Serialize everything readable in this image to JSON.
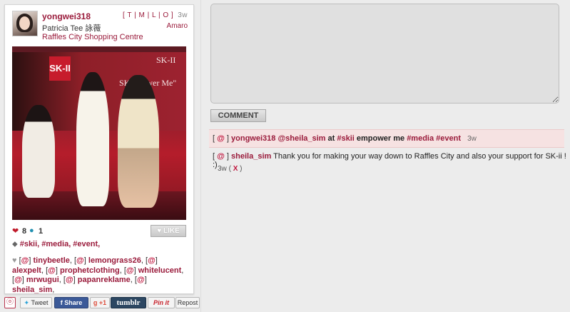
{
  "post": {
    "username": "yongwei318",
    "links": [
      "T",
      "M",
      "L",
      "O"
    ],
    "time": "3w",
    "filter": "Amaro",
    "full_name": "Patricia Tee 詠薇",
    "location": "Raffles City Shopping Centre",
    "photo_text": {
      "brand": "SK-II",
      "brand_small": "SK-II",
      "slogan": "SK-I  power Me\""
    },
    "likes_count": "8",
    "comments_count": "1",
    "like_button_label": "LIKE",
    "tags": "#skii, #media, #event,",
    "liked_by": [
      "tinybeetle",
      "lemongrass26",
      "alexpelt",
      "prophetclothing",
      "whitelucent",
      "mrwugui",
      "papanreklame",
      "sheila_sim"
    ]
  },
  "share": {
    "instagram": "ⓞ",
    "tweet": "Tweet",
    "facebook": "Share",
    "gplus": "+1",
    "gplus_icon": "g",
    "tumblr": "tumblr",
    "pinterest": "Pin it",
    "repost": "Repost"
  },
  "comment_form": {
    "value": "",
    "placeholder": "",
    "submit_label": "COMMENT"
  },
  "caption": {
    "user": "yongwei318",
    "mention": "@sheila_sim",
    "text_plain": "at",
    "tag1": "#skii",
    "text_plain2": "empower me",
    "tag2": "#media",
    "tag3": "#event",
    "time": "3w"
  },
  "comments": [
    {
      "user": "sheila_sim",
      "text": "Thank you for making your way down to Raffles City and also your support for SK-ii ! :)",
      "time": "3w",
      "delete_label": "X"
    }
  ],
  "colors": {
    "accent": "#9a1b3b",
    "at_symbol": "#c0163e",
    "caption_bg": "#f6e2e2",
    "page_bg": "#ececec"
  },
  "icons": {
    "heart": "heart-icon",
    "comment": "speech-bubble-icon",
    "tag": "tag-icon",
    "likers": "heart-outline-icon"
  }
}
